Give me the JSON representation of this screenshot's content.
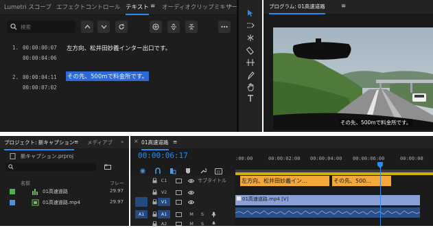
{
  "colors": {
    "accent": "#2d8ceb",
    "selection": "#2d6ad6",
    "caption_clip": "#f3a83b",
    "video_clip": "#8aa0d8",
    "audio_clip": "#2b4f88",
    "proj_green": "#4fb04f",
    "proj_blue": "#4f8fd8"
  },
  "text_panel": {
    "tabs": [
      "Lumetri スコープ",
      "エフェクトコントロール",
      "テキスト",
      "オーディオクリップミキサー"
    ],
    "menu_icon": "≡",
    "more_icon": "»",
    "search_placeholder": "検索",
    "captions": [
      {
        "index": "1.",
        "in": "00:00:00:07",
        "out": "00:00:04:06",
        "text": "左方向、松井田妙義インター出口です。"
      },
      {
        "index": "2.",
        "in": "00:00:04:11",
        "out": "00:00:07:02",
        "text": "その先、500mで料金所です。"
      }
    ]
  },
  "program": {
    "title": "プログラム: 01高速道路",
    "menu_icon": "≡",
    "subtitle": "その先、500mで料金所です。"
  },
  "project": {
    "tabs": [
      "プロジェクト: 新キャプション",
      "メディアブ"
    ],
    "menu_icon": "≡",
    "more_icon": "»",
    "file": "新キャプション.prproj",
    "col_name": "名前",
    "col_fps": "フレー",
    "items": [
      {
        "name": "01高速道路",
        "fps": "29.97"
      },
      {
        "name": "01高速道路.mp4",
        "fps": "29.97"
      }
    ]
  },
  "timeline": {
    "close": "×",
    "title": "01高速道路",
    "menu_icon": "≡",
    "timecode": "00:00:06:17",
    "ruler": [
      ":00:00",
      "00:00:02:00",
      "00:00:04:00",
      "00:00:06:00",
      "00:00:08"
    ],
    "tracks": [
      {
        "id": "C1",
        "label": "サブタイトル"
      },
      {
        "id": "V2",
        "label": ""
      },
      {
        "id": "V1",
        "label": "",
        "patch": "V1"
      },
      {
        "id": "A1",
        "label": "",
        "patch": "A1"
      },
      {
        "id": "A2",
        "label": ""
      }
    ],
    "mute": "M",
    "solo": "S",
    "clips": {
      "caption1": "左方向、松井田妙義イン...",
      "caption2": "その先、500...",
      "video": "01高速道路.mp4 [V]"
    }
  }
}
